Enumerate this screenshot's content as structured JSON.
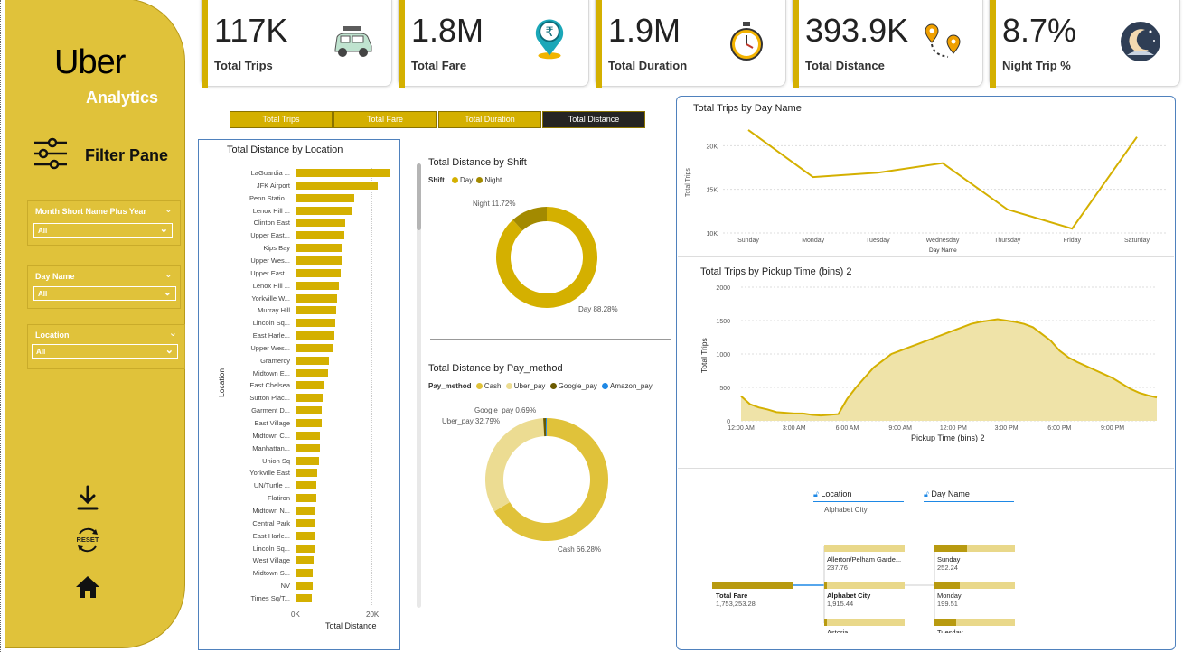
{
  "brand": {
    "logo": "Uber",
    "subtitle": "Analytics"
  },
  "filter_pane": {
    "title": "Filter Pane",
    "slicers": [
      {
        "label": "Month Short Name Plus Year",
        "value": "All"
      },
      {
        "label": "Day Name",
        "value": "All"
      },
      {
        "label": "Location",
        "value": "All"
      }
    ]
  },
  "side_actions": {
    "reset_label": "RESET"
  },
  "kpis": [
    {
      "value": "117K",
      "label": "Total Trips",
      "icon": "car-icon"
    },
    {
      "value": "1.8M",
      "label": "Total Fare",
      "icon": "rupee-pin-icon"
    },
    {
      "value": "1.9M",
      "label": "Total Duration",
      "icon": "stopwatch-icon"
    },
    {
      "value": "393.9K",
      "label": "Total Distance",
      "icon": "route-pins-icon"
    },
    {
      "value": "8.7%",
      "label": "Night Trip %",
      "icon": "moon-icon"
    }
  ],
  "tabs": [
    "Total Trips",
    "Total Fare",
    "Total Duration",
    "Total Distance"
  ],
  "active_tab": "Total Distance",
  "colors": {
    "gold": "#d4b000",
    "dark_gold": "#a38a00",
    "light_gold": "#ecdc92",
    "google": "#6b5a00",
    "amazon": "#1e88e5"
  },
  "location_chart": {
    "title": "Total Distance by Location",
    "ylabel": "Location",
    "xlabel": "Total Distance",
    "ticks": [
      "0K",
      "20K"
    ]
  },
  "shift_chart": {
    "title": "Total Distance by Shift",
    "legend_title": "Shift",
    "legend": [
      "Day",
      "Night"
    ],
    "label_night": "Night 11.72%",
    "label_day": "Day 88.28%"
  },
  "pay_chart": {
    "title": "Total Distance by Pay_method",
    "legend_title": "Pay_method",
    "legend": [
      "Cash",
      "Uber_pay",
      "Google_pay",
      "Amazon_pay"
    ],
    "label_google": "Google_pay 0.69%",
    "label_uber": "Uber_pay 32.79%",
    "label_cash": "Cash 66.28%"
  },
  "day_chart": {
    "title": "Total Trips by Day Name",
    "ylabel": "Total Trips",
    "xlabel": "Day Name",
    "yticks": [
      "20K",
      "15K",
      "10K"
    ]
  },
  "pickup_chart": {
    "title": "Total Trips by Pickup Time (bins) 2",
    "ylabel": "Total Trips",
    "xlabel": "Pickup Time (bins) 2",
    "yticks": [
      "2000",
      "1500",
      "1000",
      "500",
      "0"
    ],
    "xticks": [
      "12:00 AM",
      "3:00 AM",
      "6:00 AM",
      "9:00 AM",
      "12:00 PM",
      "3:00 PM",
      "6:00 PM",
      "9:00 PM"
    ]
  },
  "decomp_tree": {
    "col1": "Location",
    "col1_value": "Alphabet City",
    "col2": "Day Name",
    "root_label": "Total Fare",
    "root_value": "1,753,253.28",
    "loc_nodes": [
      {
        "name": "Allerton/Pelham Garde...",
        "value": "237.76"
      },
      {
        "name": "Alphabet City",
        "value": "1,915.44"
      },
      {
        "name": "Astoria",
        "value": ""
      }
    ],
    "day_nodes": [
      {
        "name": "Sunday",
        "value": "252.24"
      },
      {
        "name": "Monday",
        "value": "199.51"
      },
      {
        "name": "Tuesday",
        "value": ""
      }
    ]
  },
  "chart_data": [
    {
      "type": "bar",
      "title": "Total Distance by Location",
      "xlabel": "Total Distance",
      "ylabel": "Location",
      "xlim": [
        0,
        24000
      ],
      "categories": [
        "LaGuardia ...",
        "JFK Airport",
        "Penn Statio...",
        "Lenox Hill ...",
        "Clinton East",
        "Upper East...",
        "Kips Bay",
        "Upper Wes...",
        "Upper East...",
        "Lenox Hill ...",
        "Yorkville W...",
        "Murray Hill",
        "Lincoln Sq...",
        "East Harle...",
        "Upper Wes...",
        "Gramercy",
        "Midtown E...",
        "East Chelsea",
        "Sutton Plac...",
        "Garment D...",
        "East Village",
        "Midtown C...",
        "Manhattan...",
        "Union Sq",
        "Yorkville East",
        "UN/Turtle ...",
        "Flatiron",
        "Midtown N...",
        "Central Park",
        "East Harle...",
        "Lincoln Sq...",
        "West Village",
        "Midtown S...",
        "NV",
        "Times Sq/T..."
      ],
      "values": [
        24500,
        21500,
        15200,
        14500,
        13000,
        12800,
        12100,
        11900,
        11700,
        11300,
        10800,
        10500,
        10300,
        10000,
        9600,
        8800,
        8500,
        7500,
        7100,
        6900,
        6800,
        6400,
        6300,
        6200,
        5600,
        5500,
        5400,
        5200,
        5100,
        5000,
        4900,
        4800,
        4500,
        4400,
        4300
      ]
    },
    {
      "type": "pie",
      "title": "Total Distance by Shift",
      "labels": [
        "Day",
        "Night"
      ],
      "values": [
        88.28,
        11.72
      ]
    },
    {
      "type": "pie",
      "title": "Total Distance by Pay_method",
      "labels": [
        "Cash",
        "Uber_pay",
        "Google_pay",
        "Amazon_pay"
      ],
      "values": [
        66.28,
        32.79,
        0.69,
        0.24
      ]
    },
    {
      "type": "line",
      "title": "Total Trips by Day Name",
      "xlabel": "Day Name",
      "ylabel": "Total Trips",
      "ylim": [
        10000,
        22000
      ],
      "categories": [
        "Sunday",
        "Monday",
        "Tuesday",
        "Wednesday",
        "Thursday",
        "Friday",
        "Saturday"
      ],
      "values": [
        21800,
        16400,
        16900,
        18000,
        12700,
        10500,
        21000
      ]
    },
    {
      "type": "area",
      "title": "Total Trips by Pickup Time (bins) 2",
      "xlabel": "Pickup Time (bins) 2",
      "ylabel": "Total Trips",
      "ylim": [
        0,
        2000
      ],
      "x_hours": [
        0,
        0.5,
        1,
        1.5,
        2,
        2.5,
        3,
        3.5,
        4,
        4.5,
        5,
        5.5,
        6,
        6.5,
        7,
        7.5,
        8,
        8.5,
        9,
        9.5,
        10,
        10.5,
        11,
        11.5,
        12,
        12.5,
        13,
        13.5,
        14,
        14.5,
        15,
        15.5,
        16,
        16.5,
        17,
        17.5,
        18,
        18.5,
        19,
        19.5,
        20,
        20.5,
        21,
        21.5,
        22,
        22.5,
        23,
        23.5
      ],
      "values": [
        370,
        250,
        200,
        170,
        130,
        120,
        110,
        110,
        90,
        80,
        90,
        100,
        330,
        500,
        650,
        800,
        900,
        1000,
        1050,
        1100,
        1150,
        1200,
        1250,
        1300,
        1350,
        1400,
        1450,
        1480,
        1500,
        1520,
        1500,
        1480,
        1450,
        1400,
        1300,
        1200,
        1050,
        950,
        880,
        820,
        760,
        700,
        640,
        560,
        480,
        420,
        380,
        350
      ]
    }
  ]
}
